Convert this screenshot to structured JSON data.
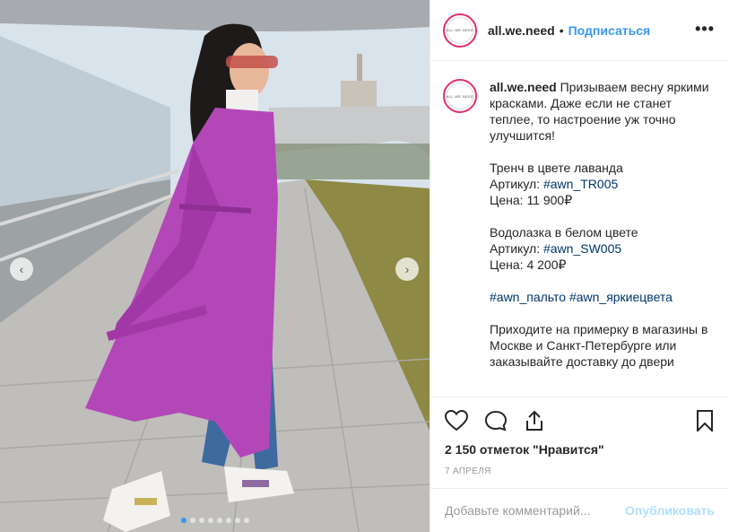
{
  "post": {
    "username": "all.we.need",
    "separator": "•",
    "follow_label": "Подписаться",
    "more_label": "•••",
    "avatar_text": "ALL.WE.NEED",
    "caption": {
      "username": "all.we.need",
      "intro": "Призываем весну яркими красками. Даже если не станет теплее, то настроение уж точно улучшится!",
      "item1_name": "Тренч в цвете лаванда",
      "item1_article_label": "Артикул: ",
      "item1_article_tag": "#awn_TR005",
      "item1_price": "Цена: 11 900₽",
      "item2_name": "Водолазка в белом цвете",
      "item2_article_label": "Артикул: ",
      "item2_article_tag": "#awn_SW005",
      "item2_price": "Цена: 4 200₽",
      "tag1": "#awn_пальто",
      "tag2": "#awn_яркиецвета",
      "outro": "Приходите на примерку в магазины в Москве и Санкт-Петербурге или заказывайте доставку до двери"
    },
    "likes": "2 150 отметок \"Нравится\"",
    "date": "7 АПРЕЛЯ",
    "comment_placeholder": "Добавьте комментарий...",
    "publish_label": "Опубликовать",
    "carousel": {
      "total": 8,
      "active_index": 0
    },
    "icons": [
      "chevron-left-icon",
      "chevron-right-icon",
      "heart-icon",
      "comment-icon",
      "share-icon",
      "bookmark-icon"
    ],
    "colors": {
      "accent": "#3897f0",
      "coat": "#b347b8",
      "tag": "#003569",
      "publish_disabled": "#b2dffc"
    }
  }
}
